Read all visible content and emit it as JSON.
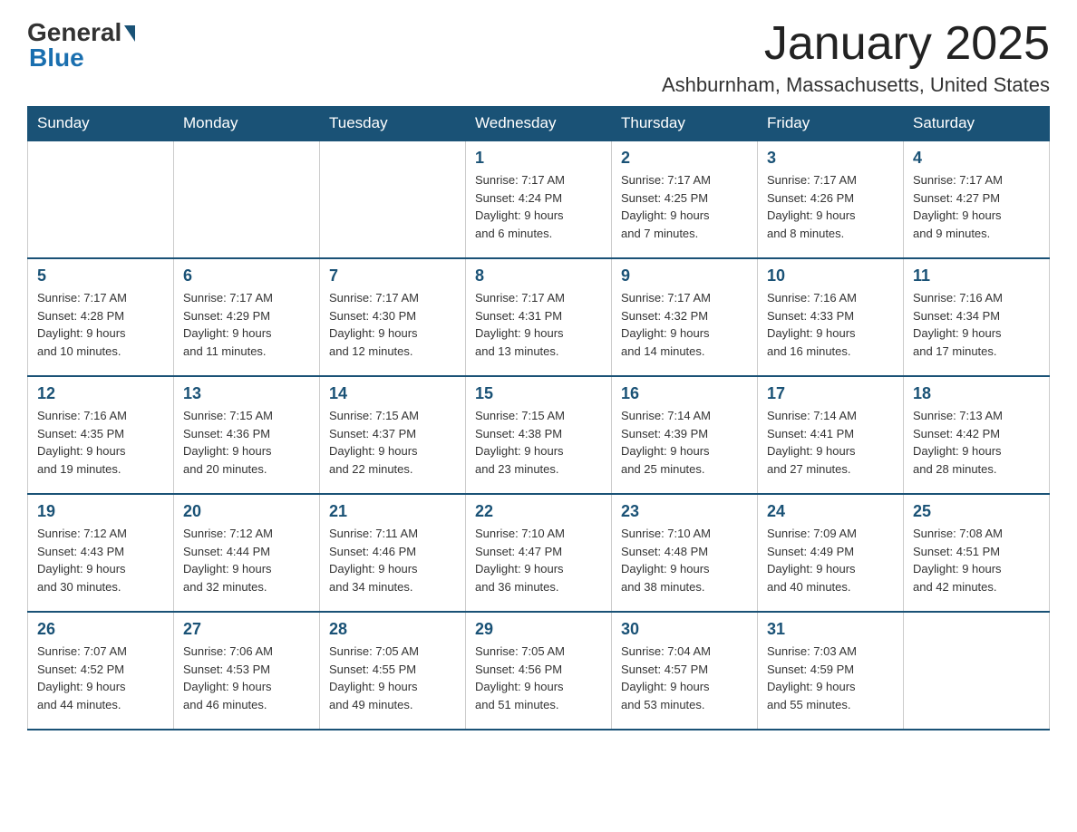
{
  "header": {
    "logo": {
      "general": "General",
      "blue": "Blue"
    },
    "title": "January 2025",
    "location": "Ashburnham, Massachusetts, United States"
  },
  "weekdays": [
    "Sunday",
    "Monday",
    "Tuesday",
    "Wednesday",
    "Thursday",
    "Friday",
    "Saturday"
  ],
  "weeks": [
    [
      {
        "day": "",
        "info": ""
      },
      {
        "day": "",
        "info": ""
      },
      {
        "day": "",
        "info": ""
      },
      {
        "day": "1",
        "info": "Sunrise: 7:17 AM\nSunset: 4:24 PM\nDaylight: 9 hours\nand 6 minutes."
      },
      {
        "day": "2",
        "info": "Sunrise: 7:17 AM\nSunset: 4:25 PM\nDaylight: 9 hours\nand 7 minutes."
      },
      {
        "day": "3",
        "info": "Sunrise: 7:17 AM\nSunset: 4:26 PM\nDaylight: 9 hours\nand 8 minutes."
      },
      {
        "day": "4",
        "info": "Sunrise: 7:17 AM\nSunset: 4:27 PM\nDaylight: 9 hours\nand 9 minutes."
      }
    ],
    [
      {
        "day": "5",
        "info": "Sunrise: 7:17 AM\nSunset: 4:28 PM\nDaylight: 9 hours\nand 10 minutes."
      },
      {
        "day": "6",
        "info": "Sunrise: 7:17 AM\nSunset: 4:29 PM\nDaylight: 9 hours\nand 11 minutes."
      },
      {
        "day": "7",
        "info": "Sunrise: 7:17 AM\nSunset: 4:30 PM\nDaylight: 9 hours\nand 12 minutes."
      },
      {
        "day": "8",
        "info": "Sunrise: 7:17 AM\nSunset: 4:31 PM\nDaylight: 9 hours\nand 13 minutes."
      },
      {
        "day": "9",
        "info": "Sunrise: 7:17 AM\nSunset: 4:32 PM\nDaylight: 9 hours\nand 14 minutes."
      },
      {
        "day": "10",
        "info": "Sunrise: 7:16 AM\nSunset: 4:33 PM\nDaylight: 9 hours\nand 16 minutes."
      },
      {
        "day": "11",
        "info": "Sunrise: 7:16 AM\nSunset: 4:34 PM\nDaylight: 9 hours\nand 17 minutes."
      }
    ],
    [
      {
        "day": "12",
        "info": "Sunrise: 7:16 AM\nSunset: 4:35 PM\nDaylight: 9 hours\nand 19 minutes."
      },
      {
        "day": "13",
        "info": "Sunrise: 7:15 AM\nSunset: 4:36 PM\nDaylight: 9 hours\nand 20 minutes."
      },
      {
        "day": "14",
        "info": "Sunrise: 7:15 AM\nSunset: 4:37 PM\nDaylight: 9 hours\nand 22 minutes."
      },
      {
        "day": "15",
        "info": "Sunrise: 7:15 AM\nSunset: 4:38 PM\nDaylight: 9 hours\nand 23 minutes."
      },
      {
        "day": "16",
        "info": "Sunrise: 7:14 AM\nSunset: 4:39 PM\nDaylight: 9 hours\nand 25 minutes."
      },
      {
        "day": "17",
        "info": "Sunrise: 7:14 AM\nSunset: 4:41 PM\nDaylight: 9 hours\nand 27 minutes."
      },
      {
        "day": "18",
        "info": "Sunrise: 7:13 AM\nSunset: 4:42 PM\nDaylight: 9 hours\nand 28 minutes."
      }
    ],
    [
      {
        "day": "19",
        "info": "Sunrise: 7:12 AM\nSunset: 4:43 PM\nDaylight: 9 hours\nand 30 minutes."
      },
      {
        "day": "20",
        "info": "Sunrise: 7:12 AM\nSunset: 4:44 PM\nDaylight: 9 hours\nand 32 minutes."
      },
      {
        "day": "21",
        "info": "Sunrise: 7:11 AM\nSunset: 4:46 PM\nDaylight: 9 hours\nand 34 minutes."
      },
      {
        "day": "22",
        "info": "Sunrise: 7:10 AM\nSunset: 4:47 PM\nDaylight: 9 hours\nand 36 minutes."
      },
      {
        "day": "23",
        "info": "Sunrise: 7:10 AM\nSunset: 4:48 PM\nDaylight: 9 hours\nand 38 minutes."
      },
      {
        "day": "24",
        "info": "Sunrise: 7:09 AM\nSunset: 4:49 PM\nDaylight: 9 hours\nand 40 minutes."
      },
      {
        "day": "25",
        "info": "Sunrise: 7:08 AM\nSunset: 4:51 PM\nDaylight: 9 hours\nand 42 minutes."
      }
    ],
    [
      {
        "day": "26",
        "info": "Sunrise: 7:07 AM\nSunset: 4:52 PM\nDaylight: 9 hours\nand 44 minutes."
      },
      {
        "day": "27",
        "info": "Sunrise: 7:06 AM\nSunset: 4:53 PM\nDaylight: 9 hours\nand 46 minutes."
      },
      {
        "day": "28",
        "info": "Sunrise: 7:05 AM\nSunset: 4:55 PM\nDaylight: 9 hours\nand 49 minutes."
      },
      {
        "day": "29",
        "info": "Sunrise: 7:05 AM\nSunset: 4:56 PM\nDaylight: 9 hours\nand 51 minutes."
      },
      {
        "day": "30",
        "info": "Sunrise: 7:04 AM\nSunset: 4:57 PM\nDaylight: 9 hours\nand 53 minutes."
      },
      {
        "day": "31",
        "info": "Sunrise: 7:03 AM\nSunset: 4:59 PM\nDaylight: 9 hours\nand 55 minutes."
      },
      {
        "day": "",
        "info": ""
      }
    ]
  ]
}
